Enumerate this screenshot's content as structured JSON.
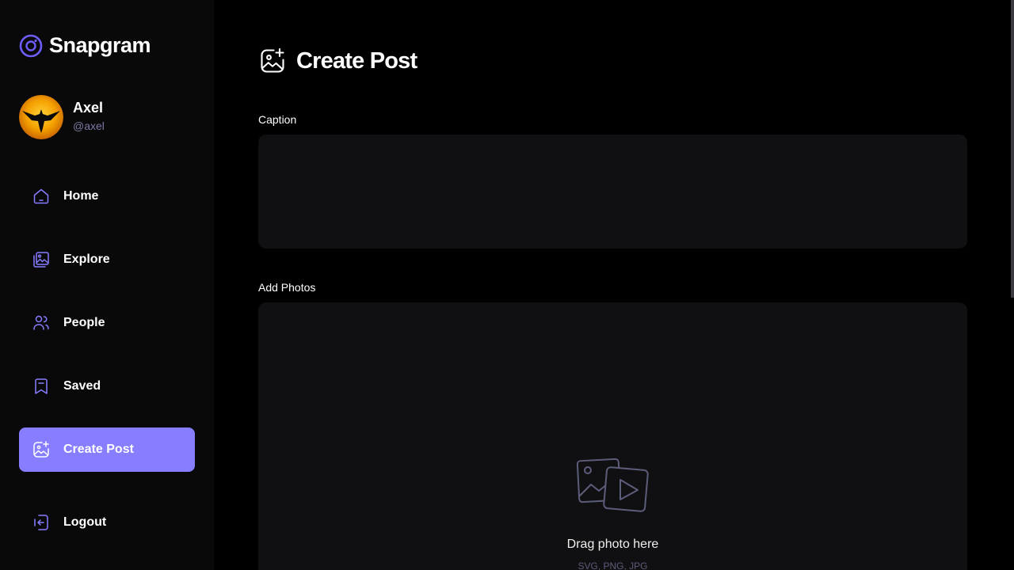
{
  "app": {
    "name": "Snapgram"
  },
  "user": {
    "name": "Axel",
    "handle": "@axel"
  },
  "sidebar": {
    "items": [
      {
        "label": "Home",
        "icon": "home-icon",
        "active": false
      },
      {
        "label": "Explore",
        "icon": "gallery-icon",
        "active": false
      },
      {
        "label": "People",
        "icon": "people-icon",
        "active": false
      },
      {
        "label": "Saved",
        "icon": "bookmark-icon",
        "active": false
      },
      {
        "label": "Create Post",
        "icon": "gallery-add-icon",
        "active": true
      }
    ],
    "logout_label": "Logout"
  },
  "page": {
    "title": "Create Post"
  },
  "form": {
    "caption_label": "Caption",
    "caption_value": "",
    "photos_label": "Add Photos",
    "drop_text": "Drag photo here",
    "drop_subtext": "SVG, PNG, JPG"
  },
  "colors": {
    "accent": "#877eff",
    "sidebar_bg": "#09090a",
    "input_bg": "#101012",
    "muted_text": "#7878a3",
    "icon_stroke": "#877eff"
  }
}
